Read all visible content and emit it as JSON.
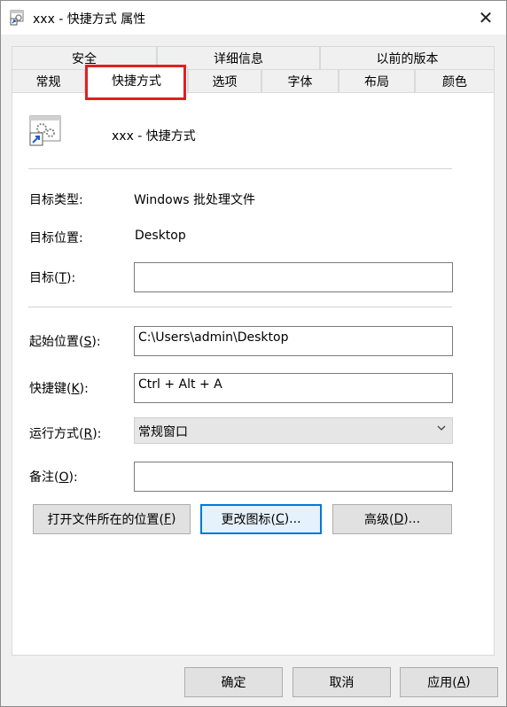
{
  "window": {
    "title": "xxx - 快捷方式 属性",
    "close_symbol": "✕"
  },
  "tabs_row1": [
    "安全",
    "详细信息",
    "以前的版本"
  ],
  "tabs_row2": [
    "常规",
    "快捷方式",
    "选项",
    "字体",
    "布局",
    "颜色"
  ],
  "header": {
    "name": "xxx - 快捷方式"
  },
  "fields": {
    "target_type_label": "目标类型:",
    "target_type_value": "Windows 批处理文件",
    "target_location_label": "目标位置:",
    "target_location_value": "Desktop",
    "target_label_pre": "目标(",
    "target_label_key": "T",
    "target_label_post": "):",
    "target_value": "",
    "start_label_pre": "起始位置(",
    "start_label_key": "S",
    "start_label_post": "):",
    "start_value": "C:\\Users\\admin\\Desktop",
    "hotkey_label_pre": "快捷键(",
    "hotkey_label_key": "K",
    "hotkey_label_post": "):",
    "hotkey_value": "Ctrl + Alt + A",
    "run_label_pre": "运行方式(",
    "run_label_key": "R",
    "run_label_post": "):",
    "run_value": "常规窗口",
    "comment_label_pre": "备注(",
    "comment_label_key": "O",
    "comment_label_post": "):",
    "comment_value": ""
  },
  "actions": {
    "open_location_pre": "打开文件所在的位置(",
    "open_location_key": "F",
    "open_location_post": ")",
    "change_icon_pre": "更改图标(",
    "change_icon_key": "C",
    "change_icon_post": ")...",
    "advanced_pre": "高级(",
    "advanced_key": "D",
    "advanced_post": ")..."
  },
  "footer": {
    "ok": "确定",
    "cancel": "取消",
    "apply_pre": "应用(",
    "apply_key": "A",
    "apply_post": ")"
  },
  "colors": {
    "highlight": "#e02020",
    "focus": "#0078d7"
  }
}
